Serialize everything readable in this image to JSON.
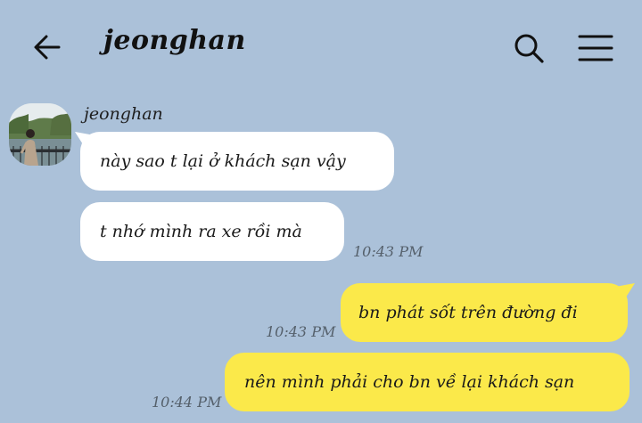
{
  "header": {
    "title": "jeonghan",
    "back_icon": "arrow-left-icon",
    "search_icon": "search-icon",
    "menu_icon": "hamburger-menu-icon"
  },
  "messages": [
    {
      "direction": "incoming",
      "text": "này sao t lại ở khách sạn vậy",
      "time": ""
    },
    {
      "direction": "incoming",
      "text": "t nhớ mình ra xe rồi mà",
      "time": "10:43 PM"
    },
    {
      "direction": "outgoing",
      "text": "bn phát sốt trên đường đi",
      "time": "10:43 PM"
    },
    {
      "direction": "outgoing",
      "text": "nên mình phải cho bn về lại khách sạn",
      "time": "10:44 PM"
    }
  ],
  "sender": {
    "name": "jeonghan"
  },
  "colors": {
    "background": "#abc1d9",
    "incoming_bubble": "#ffffff",
    "outgoing_bubble": "#fbe94a",
    "timestamp": "#55606b"
  }
}
